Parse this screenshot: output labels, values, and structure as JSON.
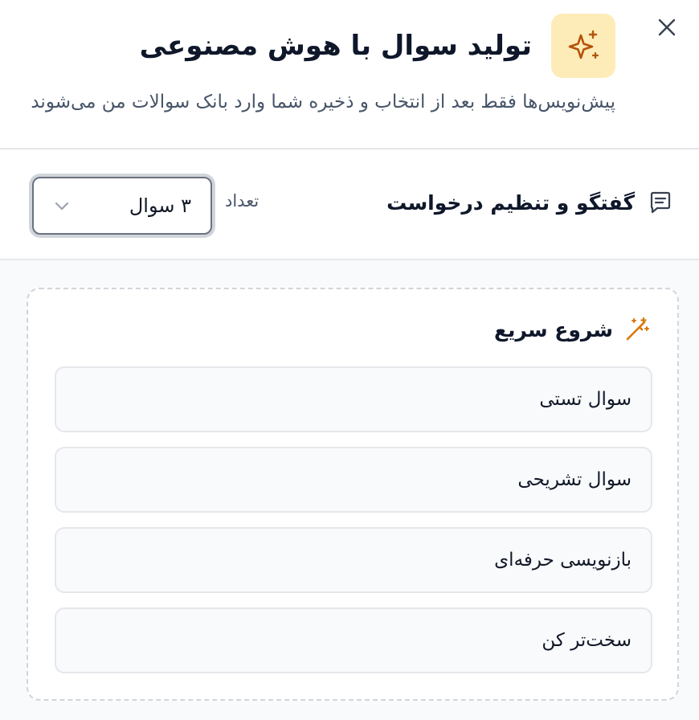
{
  "dialog": {
    "title": "تولید سوال با هوش مصنوعی",
    "subtitle": "پیش‌نویس‌ها فقط بعد از انتخاب و ذخیره شما وارد بانک سوالات من می‌شوند",
    "icons": {
      "close": "close-icon",
      "badge": "sparkles-icon"
    },
    "colors": {
      "badge_bg": "#fdecb8",
      "badge_icon": "#b45309",
      "accent": "#d97706"
    }
  },
  "toolbar": {
    "section_label": "گفتگو و تنظیم درخواست",
    "section_icon": "chat-icon",
    "count_label": "تعداد",
    "count_value": "۳ سوال"
  },
  "quick_start": {
    "title": "شروع سریع",
    "icon": "magic-wand-icon",
    "items": [
      {
        "label": "سوال تستی"
      },
      {
        "label": "سوال تشریحی"
      },
      {
        "label": "بازنویسی حرفه‌ای"
      },
      {
        "label": "سخت‌تر کن"
      }
    ]
  }
}
